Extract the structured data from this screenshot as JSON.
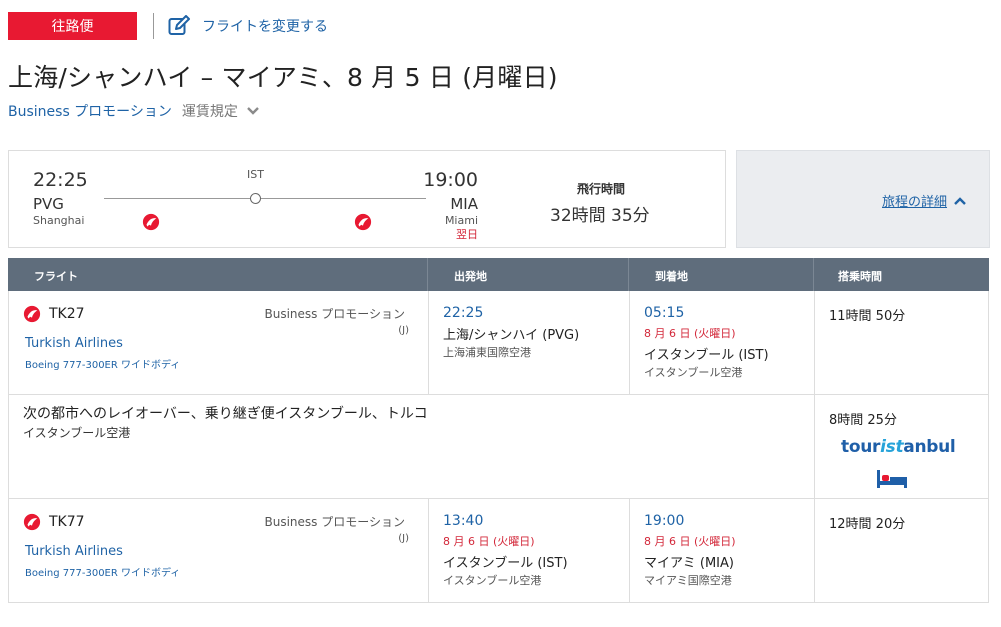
{
  "header": {
    "badge": "往路便",
    "change_flight": "フライトを変更する",
    "route_title": "上海/シャンハイ – マイアミ、8 月 5 日 (月曜日)",
    "fare_class": "Business プロモーション",
    "fare_rules": "運賃規定"
  },
  "summary": {
    "dep_time": "22:25",
    "dep_code": "PVG",
    "dep_city": "Shanghai",
    "stop_code": "IST",
    "arr_time": "19:00",
    "arr_code": "MIA",
    "arr_city": "Miami",
    "arr_nextday": "翌日",
    "duration_label": "飛行時間",
    "duration_value": "32時間 35分",
    "details_link": "旅程の詳細"
  },
  "table": {
    "headers": [
      "フライト",
      "出発地",
      "到着地",
      "搭乗時間"
    ],
    "segments": [
      {
        "flight_no": "TK27",
        "airline": "Turkish Airlines",
        "aircraft": "Boeing 777-300ER ワイドボディ",
        "cabin": "Business プロモーション",
        "booking_class": "(J)",
        "dep_time": "22:25",
        "dep_date": "",
        "dep_city": "上海/シャンハイ (PVG)",
        "dep_airport": "上海浦東国際空港",
        "arr_time": "05:15",
        "arr_date": "8 月 6 日 (火曜日)",
        "arr_city": "イスタンブール (IST)",
        "arr_airport": "イスタンブール空港",
        "ground_time": "11時間 50分"
      },
      {
        "flight_no": "TK77",
        "airline": "Turkish Airlines",
        "aircraft": "Boeing 777-300ER ワイドボディ",
        "cabin": "Business プロモーション",
        "booking_class": "(J)",
        "dep_time": "13:40",
        "dep_date": "8 月 6 日 (火曜日)",
        "dep_city": "イスタンブール (IST)",
        "dep_airport": "イスタンブール空港",
        "arr_time": "19:00",
        "arr_date": "8 月 6 日 (火曜日)",
        "arr_city": "マイアミ (MIA)",
        "arr_airport": "マイアミ国際空港",
        "ground_time": "12時間 20分"
      }
    ],
    "layover": {
      "text": "次の都市へのレイオーバー、乗り継ぎ便イスタンブール、トルコ",
      "airport": "イスタンブール空港",
      "time": "8時間 25分",
      "logo_tour": "tour",
      "logo_ist": "ist",
      "logo_anbul": "anbul"
    }
  },
  "icons": {
    "brand_red": "#e81932",
    "link_blue": "#1f63a6",
    "header_gray": "#5f6d7c",
    "edit": "edit-icon",
    "chevron": "chevron-down-icon",
    "chevron_up": "chevron-up-icon",
    "airline_logo": "turkish-airlines-logo-icon",
    "bed": "bed-icon"
  }
}
